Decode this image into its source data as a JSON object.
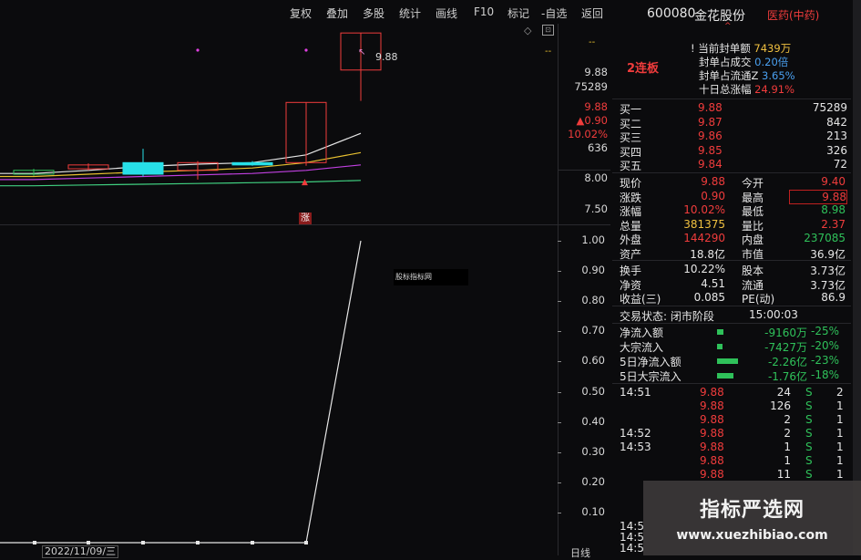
{
  "toolbar": {
    "items": [
      "复权",
      "叠加",
      "多股",
      "统计",
      "画线",
      "F10",
      "标记",
      "-自选",
      "返回"
    ]
  },
  "chart_data": [
    {
      "type": "candlestick",
      "title": "",
      "note_high": "9.88",
      "limit_up_label": "涨",
      "y_ticks": [
        "9.88",
        "75289",
        "9.88",
        "▲0.90",
        "10.02%",
        "636",
        "8.00",
        "7.50"
      ],
      "dashes": [
        "--",
        "--"
      ],
      "candles": [
        {
          "open": 8.1,
          "close": 8.05,
          "high": 8.12,
          "low": 8.03,
          "dir": "down"
        },
        {
          "open": 8.12,
          "close": 8.17,
          "high": 8.19,
          "low": 8.1,
          "dir": "up"
        },
        {
          "open": 8.05,
          "close": 8.2,
          "high": 8.38,
          "low": 8.02,
          "dir": "cyan"
        },
        {
          "open": 8.1,
          "close": 8.2,
          "high": 8.22,
          "low": 7.98,
          "dir": "up"
        },
        {
          "open": 8.17,
          "close": 8.2,
          "high": 8.22,
          "low": 8.16,
          "dir": "cyan"
        },
        {
          "open": 8.2,
          "close": 8.98,
          "high": 8.98,
          "low": 8.16,
          "dir": "up"
        },
        {
          "open": 9.4,
          "close": 9.88,
          "high": 9.88,
          "low": 9.0,
          "dir": "up"
        }
      ]
    },
    {
      "type": "line",
      "title": "",
      "indicator_label": "股标指标网",
      "y_ticks": [
        "1.00",
        "0.90",
        "0.80",
        "0.70",
        "0.60",
        "0.50",
        "0.40",
        "0.30",
        "0.20",
        "0.10"
      ],
      "x": [
        0,
        1,
        2,
        3,
        4,
        5,
        6,
        7,
        8
      ],
      "values": [
        0,
        0,
        0,
        0,
        0,
        0,
        0,
        0,
        1.0
      ],
      "date_label": "2022/11/09/三",
      "period_label": "日线"
    }
  ],
  "panel": {
    "header": {
      "code": "600080",
      "name": "金花股份",
      "sector": "医药(中药)",
      "sub": "^"
    },
    "limit": {
      "tag": "2连板",
      "items": [
        {
          "label": "! 当前封单额",
          "value": "7439万"
        },
        {
          "label": "封单占成交",
          "value": "0.20倍"
        },
        {
          "label": "封单占流通Z",
          "value": "3.65%"
        },
        {
          "label": "十日总涨幅",
          "value": "24.91%"
        }
      ]
    },
    "bids": [
      {
        "label": "买一",
        "price": "9.88",
        "vol": "75289"
      },
      {
        "label": "买二",
        "price": "9.87",
        "vol": "842"
      },
      {
        "label": "买三",
        "price": "9.86",
        "vol": "213"
      },
      {
        "label": "买四",
        "price": "9.85",
        "vol": "326"
      },
      {
        "label": "买五",
        "price": "9.84",
        "vol": "72"
      }
    ],
    "quote": [
      {
        "l1": "现价",
        "v1": "9.88",
        "l2": "今开",
        "v2": "9.40"
      },
      {
        "l1": "涨跌",
        "v1": "0.90",
        "l2": "最高",
        "v2": "9.88"
      },
      {
        "l1": "涨幅",
        "v1": "10.02%",
        "l2": "最低",
        "v2": "8.98"
      },
      {
        "l1": "总量",
        "v1": "381375",
        "l2": "量比",
        "v2": "2.37"
      },
      {
        "l1": "外盘",
        "v1": "144290",
        "l2": "内盘",
        "v2": "237085"
      },
      {
        "l1": "资产",
        "v1": "18.8亿",
        "l2": "市值",
        "v2": "36.9亿"
      }
    ],
    "fund": [
      {
        "l1": "换手",
        "v1": "10.22%",
        "l2": "股本",
        "v2": "3.73亿"
      },
      {
        "l1": "净资",
        "v1": "4.51",
        "l2": "流通",
        "v2": "3.73亿"
      },
      {
        "l1": "收益(三)",
        "v1": "0.085",
        "l2": "PE(动)",
        "v2": "86.9"
      }
    ],
    "status": {
      "label": "交易状态: 闭市阶段",
      "time": "15:00:03"
    },
    "flows": [
      {
        "label": "净流入额",
        "value": "-9160万",
        "pct": "-25%",
        "bar": 0.25
      },
      {
        "label": "大宗流入",
        "value": "-7427万",
        "pct": "-20%",
        "bar": 0.2
      },
      {
        "label": "5日净流入额",
        "value": "-2.26亿",
        "pct": "-23%",
        "bar": 0.9
      },
      {
        "label": "5日大宗流入",
        "value": "-1.76亿",
        "pct": "-18%",
        "bar": 0.7
      }
    ],
    "ticks": [
      {
        "time": "14:51",
        "price": "9.88",
        "vol": "24",
        "side": "S",
        "n": "2"
      },
      {
        "time": "",
        "price": "9.88",
        "vol": "126",
        "side": "S",
        "n": "1"
      },
      {
        "time": "",
        "price": "9.88",
        "vol": "2",
        "side": "S",
        "n": "1"
      },
      {
        "time": "14:52",
        "price": "9.88",
        "vol": "2",
        "side": "S",
        "n": "1"
      },
      {
        "time": "14:53",
        "price": "9.88",
        "vol": "1",
        "side": "S",
        "n": "1"
      },
      {
        "time": "",
        "price": "9.88",
        "vol": "1",
        "side": "S",
        "n": "1"
      },
      {
        "time": "",
        "price": "9.88",
        "vol": "11",
        "side": "S",
        "n": "1"
      }
    ],
    "tail_times": [
      "14:5",
      "14:5",
      "14:5"
    ]
  },
  "watermark": {
    "title": "指标严选网",
    "url": "www.xuezhibiao.com"
  },
  "colors": {
    "up": "#f03c3c",
    "down": "#2fc15a",
    "cyan": "#27e0e8",
    "ma1": "#e6e6e6",
    "ma2": "#e8c030",
    "ma3": "#c040e0",
    "ma4": "#40d080"
  }
}
